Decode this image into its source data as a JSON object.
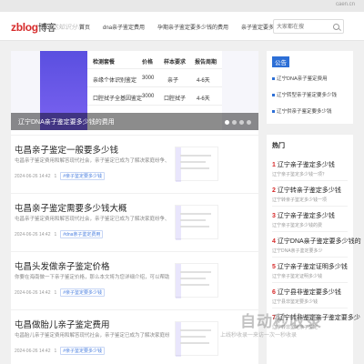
{
  "topbar": {
    "url_text": "caen.cn"
  },
  "header": {
    "logo_main": "zblog",
    "logo_accent": "博客",
    "slogan": "传达知识分享",
    "nav": [
      "首页",
      "dna亲子鉴定费用",
      "孕期亲子鉴定要多少钱的费用",
      "亲子鉴定要多少钱"
    ],
    "search_placeholder": "大家都在搜"
  },
  "banner": {
    "table": {
      "headers": [
        "检测套餐",
        "价格",
        "样本要求",
        "报告周期"
      ],
      "rows": [
        [
          "亲缘个体识别鉴定",
          "3000",
          "亲子",
          "4-6天"
        ],
        [
          "口腔拭子全基因鉴定",
          "3000",
          "口腔拭子",
          "4-6天"
        ]
      ]
    },
    "caption": "辽宁DNA亲子鉴定要多少钱的费用"
  },
  "articles": [
    {
      "title": "屯昌亲子鉴定一般要多少钱",
      "desc": "屯昌亲子鉴定费用和解答现代社会，亲子鉴定已成为了解决家庭纷争、亲子关系...",
      "date": "2024-06-26 14:42",
      "views": "1",
      "tag": "#亲子鉴定要多少钱"
    },
    {
      "title": "屯昌亲子鉴定需要多少钱大概",
      "desc": "屯昌亲子鉴定费用和解答现代社会，亲子鉴定已成为了解决家庭纷争、证明亲子...",
      "date": "2024-06-26 14:42",
      "views": "1",
      "tag": "#dna亲子鉴定费用"
    },
    {
      "title": "屯昌头发做亲子鉴定价格",
      "desc": "你要在海南做一下亲子鉴定价格，那么本文将为您详细介绍，可以帮助需...",
      "date": "2024-06-26 14:42",
      "views": "1",
      "tag": "#亲子鉴定要多少钱"
    },
    {
      "title": "屯昌做胎儿亲子鉴定费用",
      "desc": "屯昌胎儿亲子鉴定费用和解答现代社会，亲子鉴定已成为了解决家庭纷争的...",
      "date": "2024-06-26 14:42",
      "views": "1",
      "tag": "#亲子鉴定要多少钱"
    }
  ],
  "aside": {
    "notice_label": "公告",
    "notices": [
      "辽宁DNA亲子鉴定费用",
      "辽宁转型亲子鉴定要多少钱",
      "辽宁供亲子鉴定要多少钱"
    ],
    "hot_label": "热门",
    "hot": [
      {
        "n": "1",
        "title": "辽宁亲子鉴定多少钱",
        "sub": "辽宁亲子鉴定多少钱一项？"
      },
      {
        "n": "2",
        "title": "辽宁转亲子鉴定多少钱",
        "sub": "辽宁转亲子鉴定多少钱一项"
      },
      {
        "n": "3",
        "title": "辽宁亲子鉴定多少钱",
        "sub": "辽宁亲子鉴定多少钱的费"
      },
      {
        "n": "4",
        "title": "辽宁DNA亲子鉴定要多少钱的",
        "sub": "辽宁DNA亲子鉴定要多少"
      },
      {
        "n": "5",
        "title": "辽宁亲子鉴定证明多少钱",
        "sub": "辽宁亲子鉴定证明多少钱"
      },
      {
        "n": "6",
        "title": "辽宁县非鉴定要多少钱",
        "sub": "辽宁县非鉴定要多少钱"
      },
      {
        "n": "7",
        "title": "辽宁转非鉴定亲子鉴定要多少",
        "sub": "辽宁转非鉴定亲子鉴定"
      }
    ]
  },
  "watermark": {
    "title": "自动秒收录",
    "sub": "上线秒收录一来访一次一秒收录"
  },
  "colors": {
    "accent_blue": "#2d6fd6",
    "logo_red": "#d62a2a",
    "banner_purple": "#5a4fe0"
  }
}
